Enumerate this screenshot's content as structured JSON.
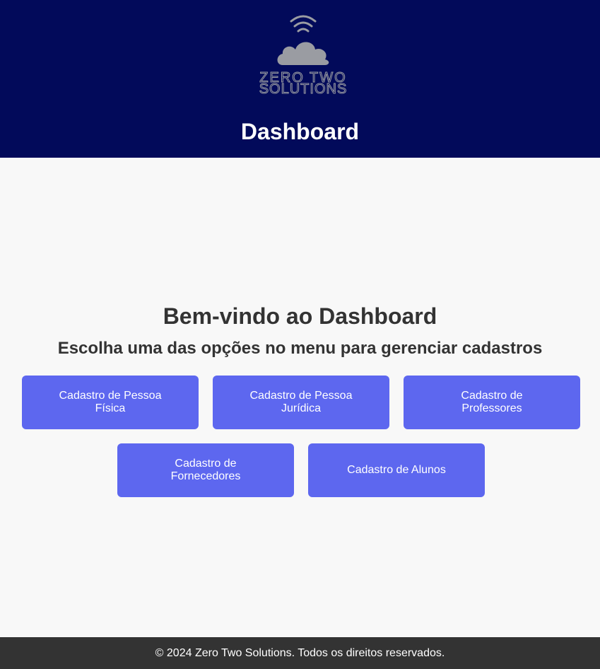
{
  "header": {
    "logo_text_line1": "ZERO TWO",
    "logo_text_line2": "SOLUTIONS",
    "logo_icon": "cloud-wifi-icon",
    "title": "Dashboard",
    "background_color": "#020a5a"
  },
  "main": {
    "welcome": "Bem-vindo ao Dashboard",
    "subtitle": "Escolha uma das opções no menu para gerenciar cadastros",
    "buttons": [
      {
        "label": "Cadastro de Pessoa Física"
      },
      {
        "label": "Cadastro de Pessoa Jurídica"
      },
      {
        "label": "Cadastro de Professores"
      },
      {
        "label": "Cadastro de Fornecedores"
      },
      {
        "label": "Cadastro de Alunos"
      }
    ],
    "button_color": "#5d67ef"
  },
  "footer": {
    "text": "© 2024 Zero Two Solutions. Todos os direitos reservados.",
    "background_color": "#333333"
  }
}
